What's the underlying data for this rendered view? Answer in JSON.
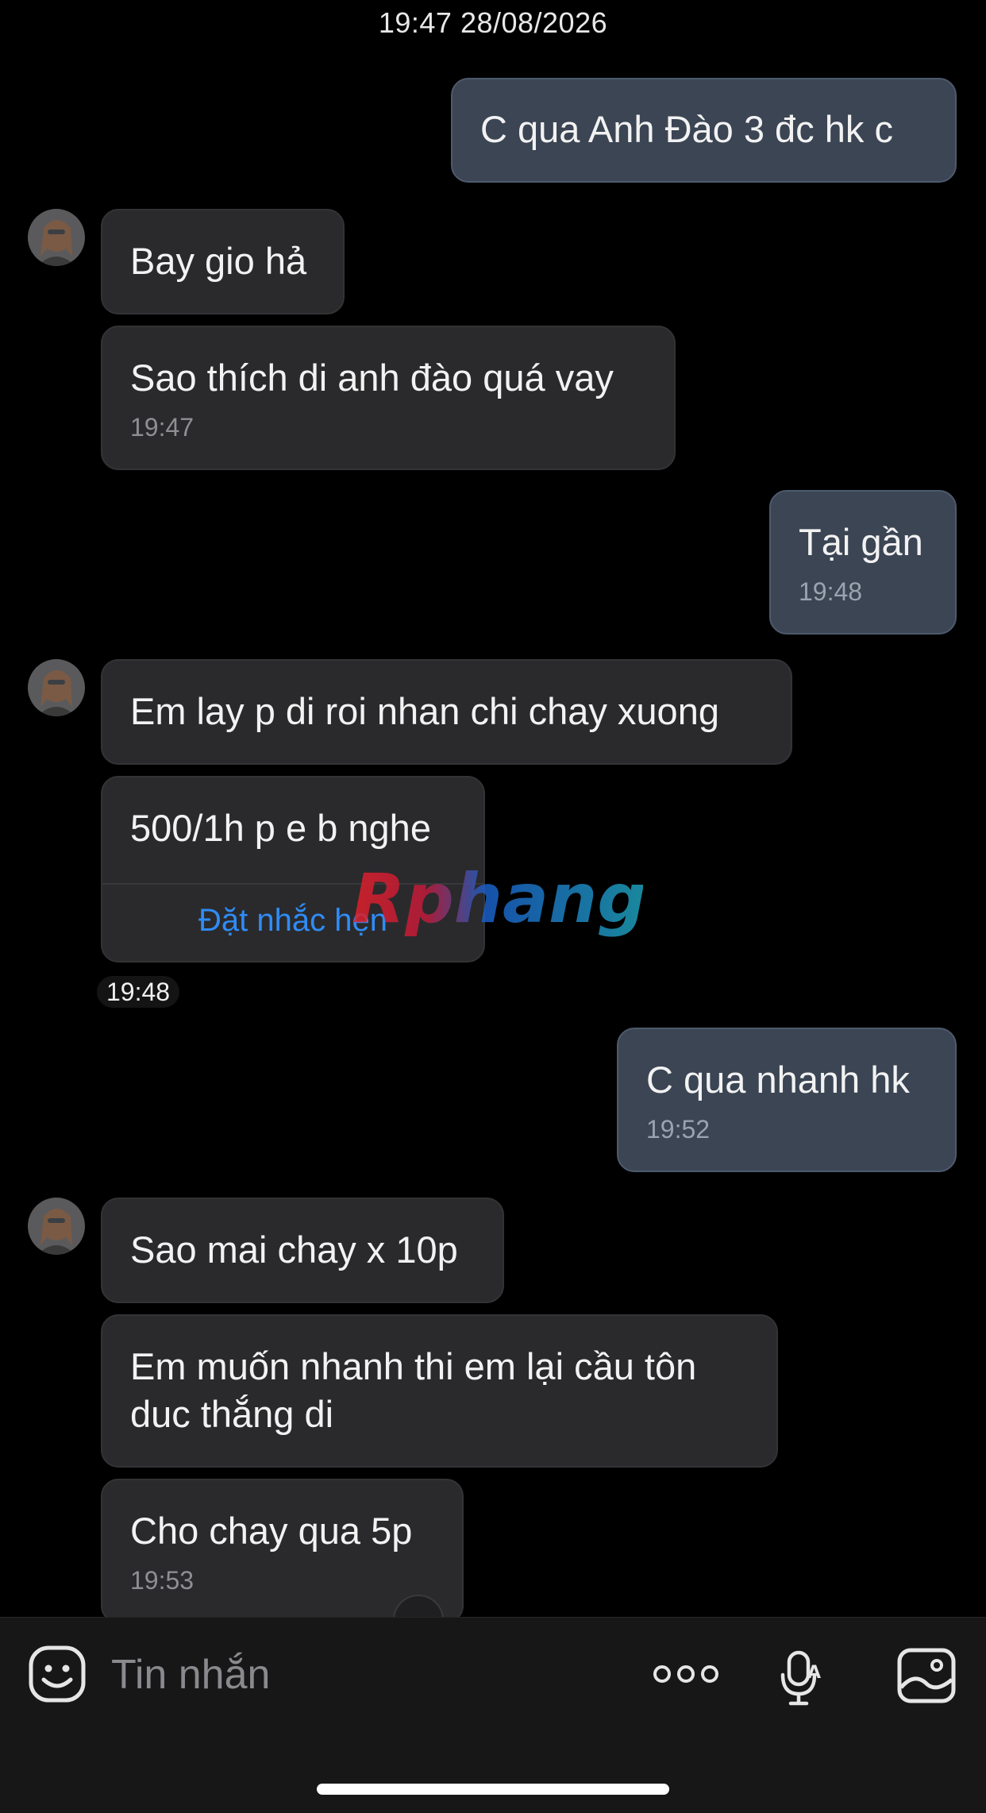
{
  "date_header": "19:47 28/08/2026",
  "messages": [
    {
      "text": "C qua Anh Đào 3 đc hk c",
      "time": ""
    },
    {
      "text": "Bay gio hả",
      "time": ""
    },
    {
      "text": "Sao thích di anh đào quá vay",
      "time": "19:47"
    },
    {
      "text": "Tại gần",
      "time": "19:48"
    },
    {
      "text": "Em lay p di roi nhan chi chay xuong",
      "time": ""
    },
    {
      "text": "500/1h p e b nghe",
      "reminder_link": "Đặt nhắc hẹn"
    },
    {
      "text": "C qua nhanh hk",
      "time": "19:52"
    },
    {
      "text": "Sao mai chay x 10p",
      "time": ""
    },
    {
      "text": "Em muốn nhanh thi em lại cầu tôn\nduc thắng di",
      "time": ""
    },
    {
      "text": "Cho chay qua 5p",
      "time": "19:53"
    }
  ],
  "standalone_time": "19:48",
  "watermark_text": "Rphang",
  "composer": {
    "placeholder": "Tin nhắn",
    "icons": [
      "emoji-icon",
      "more-icon",
      "voice-to-text-icon",
      "image-icon"
    ]
  },
  "colors": {
    "background": "#000000",
    "incoming_bubble": "#2a2a2c",
    "outgoing_bubble": "#3b4554",
    "link": "#2f8cf6"
  }
}
